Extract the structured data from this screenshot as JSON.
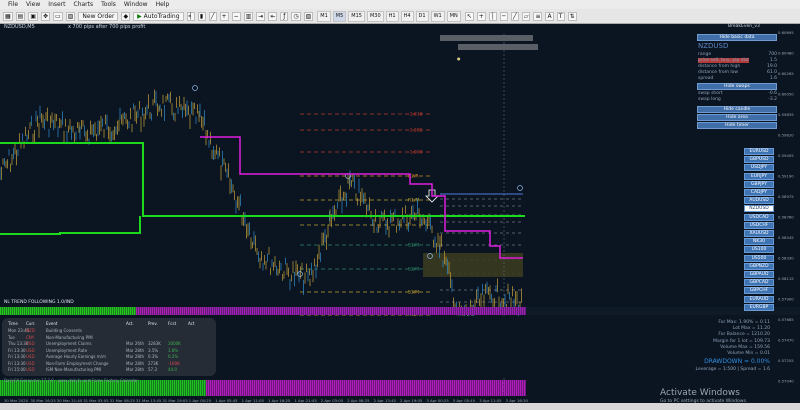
{
  "menu": [
    "File",
    "View",
    "Insert",
    "Charts",
    "Tools",
    "Window",
    "Help"
  ],
  "toolbar": {
    "new_order": "New Order",
    "auto_trading": "AutoTrading",
    "timeframes": [
      "M1",
      "M5",
      "M15",
      "M30",
      "H1",
      "H4",
      "D1",
      "W1",
      "MN"
    ]
  },
  "chart": {
    "symbol": "NZDUSD,M5",
    "subtitle": "x 700 pips after 700 pips profit",
    "top_label_1": "",
    "top_label_2": "",
    "corner": "BreakEven_v3",
    "indicator": "NL TREND FOLLOWING 1.0/IND",
    "footer_left": "DailyFX Economic 17.3.0 · www.dailyfx.com",
    "footer_mid": "Forex Factory Calendar"
  },
  "time_axis": [
    "30 Mar 2020",
    "30 Mar 16:25",
    "30 Mar 21:45",
    "31 Mar 03:05",
    "31 Mar 08:25",
    "31 Mar 13:45",
    "31 Mar 19:05",
    "1 Apr 00:25",
    "1 Apr 05:45",
    "1 Apr 11:05",
    "1 Apr 16:25",
    "1 Apr 21:45",
    "2 Apr 03:05",
    "2 Apr 08:25",
    "2 Apr 13:45",
    "2 Apr 19:05",
    "3 Apr 00:25",
    "3 Apr 05:45",
    "3 Apr 11:05",
    "3 Apr 16:30"
  ],
  "price_axis": [
    "0.60695",
    "0.60480",
    "0.60265",
    "0.60050",
    "0.59835",
    "0.59620",
    "0.59405",
    "0.59190",
    "0.58975",
    "0.58760",
    "0.58545",
    "0.58330",
    "0.58115",
    "0.57900",
    "0.57685",
    "0.57470",
    "0.57255",
    "0.57040"
  ],
  "fib_levels": [
    "-1.618",
    "-1.382",
    "-1.000",
    "R2/R",
    "R1/M",
    "P",
    "S1/M",
    "S2/M",
    "S3/M",
    "S2/R",
    "S3/R",
    "-3.618"
  ],
  "panel": {
    "title": "Hide basic data",
    "symbol": "NZDUSD",
    "rows": [
      {
        "label": "range",
        "value": "700"
      },
      {
        "label": "price sell, buy, pip dist",
        "value": "1.5"
      },
      {
        "label": "distance from high",
        "value": "19.0"
      },
      {
        "label": "distance from low",
        "value": "61.0"
      },
      {
        "label": "spread",
        "value": "1.6"
      }
    ],
    "swaps_btn": "Hide swaps",
    "swaps": [
      {
        "label": "swap short",
        "value": "-0.6"
      },
      {
        "label": "swap long",
        "value": "-3.2"
      }
    ],
    "candle_btn": "Hide candle",
    "area_btn": "Hide area",
    "timer_btn": "Hide timer"
  },
  "pairs": [
    "EURUSD",
    "GBPUSD",
    "USDJPY",
    "EURJPY",
    "GBPJPY",
    "CADJPY",
    "AUDUSD",
    "NZDUSD",
    "USDCAD",
    "USDCHF",
    "XAUUSD",
    "NK30",
    "US100",
    "US500",
    "GBPNZD",
    "GBPAUD",
    "GBPCAD",
    "GBPCHF",
    "EURAUD",
    "EURGBP"
  ],
  "stats": [
    "For Max: 1.90% = 0.11",
    "Lot Max = 11.20",
    "For Balance = 1210.20",
    "Margin for 1 lot = 109.73",
    "Volume Max = 159.56",
    "Volume Min = 0.01"
  ],
  "drawdown": "DRAWDOWN = 0.00%",
  "leverage": "Leverage = 1:500 | Spread = 1.6",
  "calendar": {
    "headers": [
      "Time",
      "Curr.",
      "Event",
      "Act.",
      "Prev.",
      "Fcst",
      "Act"
    ],
    "rows": [
      [
        "Mon 23:45",
        "NZD",
        "Building Consents",
        "",
        "",
        "",
        ""
      ],
      [
        "Tue",
        "CNY",
        "Non-Manufacturing PMI",
        "",
        "",
        "",
        ""
      ],
      [
        "Thu 13:30",
        "USD",
        "Unemployment Claims",
        "Mar 26th",
        "3283K",
        "3000K",
        ""
      ],
      [
        "Fri 13:30",
        "USD",
        "Unemployment Rate",
        "Mar 28th",
        "3.5%",
        "3.8%",
        ""
      ],
      [
        "Fri 13:30",
        "USD",
        "Average Hourly Earnings m/m",
        "Mar 28th",
        "0.3%",
        "0.2%",
        ""
      ],
      [
        "Fri 13:30",
        "USD",
        "Non-Farm Employment Change",
        "Mar 28th",
        "273K",
        "-100K",
        ""
      ],
      [
        "Fri 15:00",
        "USD",
        "ISM Non-Manufacturing PMI",
        "Mar 28th",
        "57.3",
        "44.0",
        ""
      ]
    ]
  },
  "windows": {
    "title": "Activate Windows",
    "sub": "Go to PC settings to activate Windows."
  }
}
